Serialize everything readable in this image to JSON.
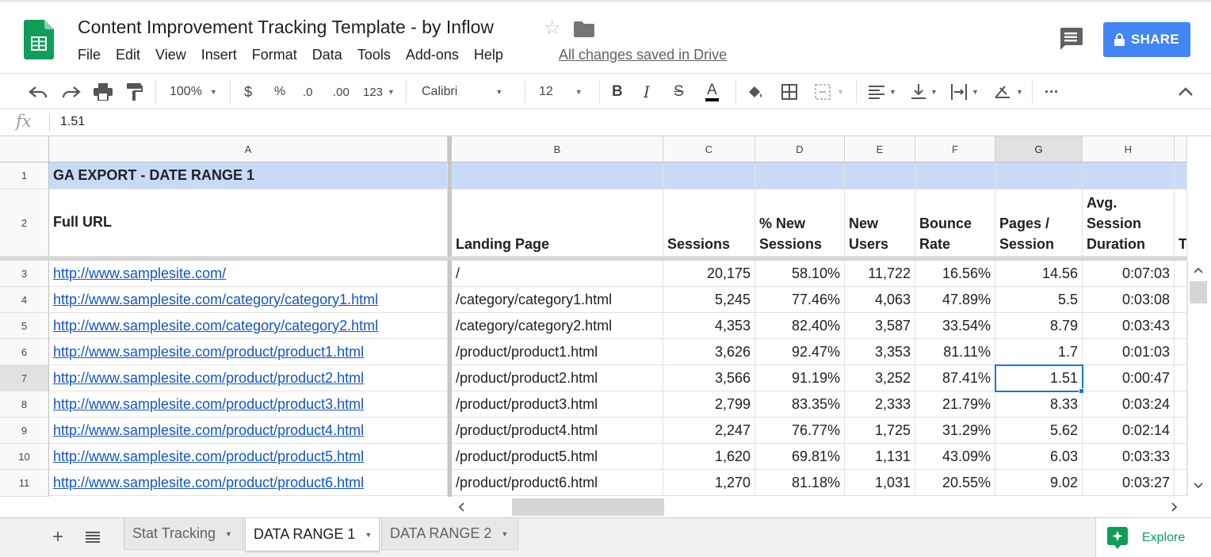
{
  "doc": {
    "title": "Content Improvement Tracking Template - by Inflow",
    "saved_status": "All changes saved in Drive",
    "share_label": "SHARE",
    "menu": [
      "File",
      "Edit",
      "View",
      "Insert",
      "Format",
      "Data",
      "Tools",
      "Add-ons",
      "Help"
    ]
  },
  "toolbar": {
    "zoom": "100%",
    "currency": "$",
    "percent": "%",
    "decrease_decimal": ".0",
    "increase_decimal": ".00",
    "more_formats": "123",
    "font": "Calibri",
    "font_size": "12",
    "bold": "B",
    "italic": "I",
    "strike": "S",
    "text_color": "A",
    "more": "···"
  },
  "formula": {
    "fx": "fx",
    "value": "1.51"
  },
  "columns": [
    "A",
    "B",
    "C",
    "D",
    "E",
    "F",
    "G",
    "H"
  ],
  "row_numbers": [
    "1",
    "2",
    "3",
    "4",
    "5",
    "6",
    "7",
    "8",
    "9",
    "10",
    "11"
  ],
  "band_title": "GA EXPORT - DATE RANGE 1",
  "headers": {
    "full_url": "Full URL",
    "landing_page": "Landing Page",
    "sessions": "Sessions",
    "pct_new_sessions": "% New Sessions",
    "new_users": "New Users",
    "bounce_rate": "Bounce Rate",
    "pages_session": "Pages / Session",
    "avg_session_duration": "Avg. Session Duration",
    "next_col_partial": "T"
  },
  "rows": [
    {
      "url": "http://www.samplesite.com/",
      "landing": "/",
      "sessions": "20,175",
      "pct_new": "58.10%",
      "new_users": "11,722",
      "bounce": "16.56%",
      "pages": "14.56",
      "duration": "0:07:03"
    },
    {
      "url": "http://www.samplesite.com/category/category1.html",
      "landing": "/category/category1.html",
      "sessions": "5,245",
      "pct_new": "77.46%",
      "new_users": "4,063",
      "bounce": "47.89%",
      "pages": "5.5",
      "duration": "0:03:08"
    },
    {
      "url": "http://www.samplesite.com/category/category2.html",
      "landing": "/category/category2.html",
      "sessions": "4,353",
      "pct_new": "82.40%",
      "new_users": "3,587",
      "bounce": "33.54%",
      "pages": "8.79",
      "duration": "0:03:43"
    },
    {
      "url": "http://www.samplesite.com/product/product1.html",
      "landing": "/product/product1.html",
      "sessions": "3,626",
      "pct_new": "92.47%",
      "new_users": "3,353",
      "bounce": "81.11%",
      "pages": "1.7",
      "duration": "0:01:03"
    },
    {
      "url": "http://www.samplesite.com/product/product2.html",
      "landing": "/product/product2.html",
      "sessions": "3,566",
      "pct_new": "91.19%",
      "new_users": "3,252",
      "bounce": "87.41%",
      "pages": "1.51",
      "duration": "0:00:47"
    },
    {
      "url": "http://www.samplesite.com/product/product3.html",
      "landing": "/product/product3.html",
      "sessions": "2,799",
      "pct_new": "83.35%",
      "new_users": "2,333",
      "bounce": "21.79%",
      "pages": "8.33",
      "duration": "0:03:24"
    },
    {
      "url": "http://www.samplesite.com/product/product4.html",
      "landing": "/product/product4.html",
      "sessions": "2,247",
      "pct_new": "76.77%",
      "new_users": "1,725",
      "bounce": "31.29%",
      "pages": "5.62",
      "duration": "0:02:14"
    },
    {
      "url": "http://www.samplesite.com/product/product5.html",
      "landing": "/product/product5.html",
      "sessions": "1,620",
      "pct_new": "69.81%",
      "new_users": "1,131",
      "bounce": "43.09%",
      "pages": "6.03",
      "duration": "0:03:33"
    },
    {
      "url": "http://www.samplesite.com/product/product6.html",
      "landing": "/product/product6.html",
      "sessions": "1,270",
      "pct_new": "81.18%",
      "new_users": "1,031",
      "bounce": "20.55%",
      "pages": "9.02",
      "duration": "0:03:27"
    }
  ],
  "sheets": {
    "tabs": [
      {
        "label": "Stat Tracking",
        "active": false
      },
      {
        "label": "DATA RANGE 1",
        "active": true
      },
      {
        "label": "DATA RANGE 2",
        "active": false
      }
    ],
    "explore_label": "Explore"
  },
  "icons": {
    "logo": "sheets-logo-icon",
    "star": "star-icon",
    "folder": "folder-icon",
    "comments": "comments-icon",
    "lock": "lock-icon"
  },
  "colors": {
    "share": "#4285f4",
    "band": "#c9daf8",
    "link": "#1155cc",
    "selection": "#1a73e8",
    "sheets_green": "#0f9d58"
  }
}
